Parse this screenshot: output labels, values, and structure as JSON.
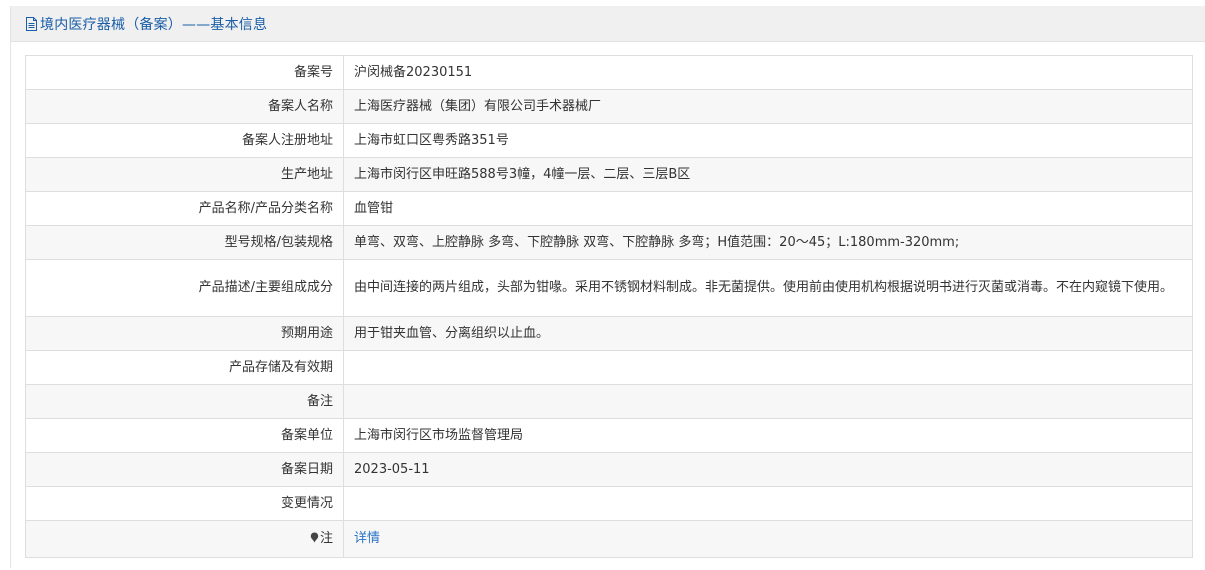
{
  "header": {
    "title": "境内医疗器械（备案）——基本信息",
    "icon": "document-icon",
    "accent_color": "#1a5ea8"
  },
  "rows": [
    {
      "label": "备案号",
      "value": "沪闵械备20230151"
    },
    {
      "label": "备案人名称",
      "value": "上海医疗器械（集团）有限公司手术器械厂"
    },
    {
      "label": "备案人注册地址",
      "value": "上海市虹口区粤秀路351号"
    },
    {
      "label": "生产地址",
      "value": "上海市闵行区申旺路588号3幢，4幢一层、二层、三层B区"
    },
    {
      "label": "产品名称/产品分类名称",
      "value": "血管钳"
    },
    {
      "label": "型号规格/包装规格",
      "value": "单弯、双弯、上腔静脉 多弯、下腔静脉 双弯、下腔静脉 多弯；H值范围：20～45；L:180mm-320mm;"
    },
    {
      "label": "产品描述/主要组成成分",
      "value": "由中间连接的两片组成，头部为钳喙。采用不锈钢材料制成。非无菌提供。使用前由使用机构根据说明书进行灭菌或消毒。不在内窥镜下使用。"
    },
    {
      "label": "预期用途",
      "value": "用于钳夹血管、分离组织以止血。"
    },
    {
      "label": "产品存储及有效期",
      "value": ""
    },
    {
      "label": "备注",
      "value": ""
    },
    {
      "label": "备案单位",
      "value": "上海市闵行区市场监督管理局"
    },
    {
      "label": "备案日期",
      "value": "2023-05-11"
    },
    {
      "label": "变更情况",
      "value": ""
    }
  ],
  "note_row": {
    "label": "注",
    "icon": "pin-icon",
    "link_label": "详情",
    "link_color": "#2b73c4"
  }
}
